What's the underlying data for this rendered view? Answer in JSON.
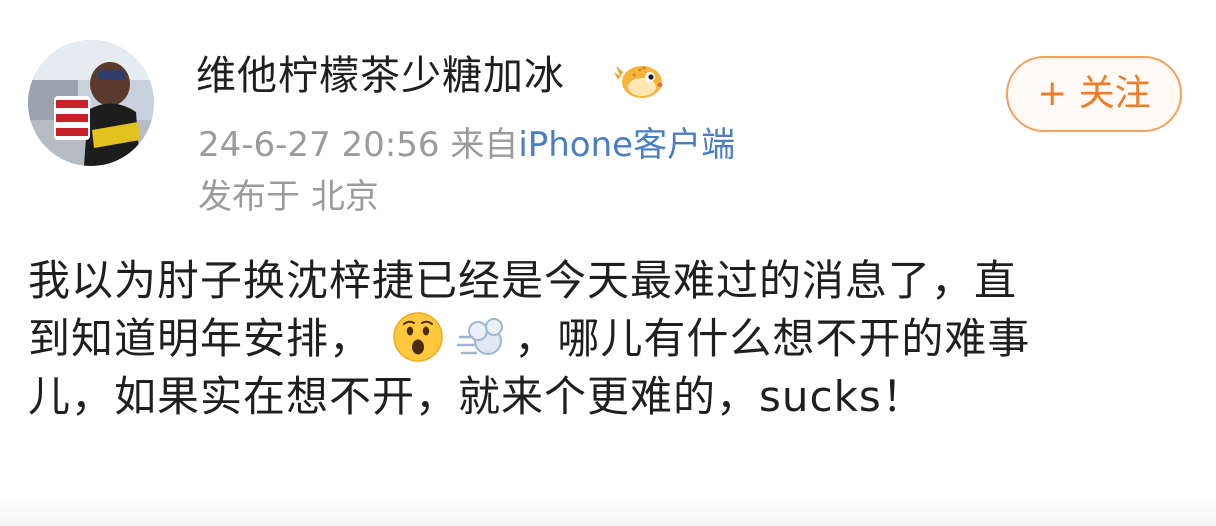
{
  "post": {
    "author": {
      "name": "维他柠檬茶少糖加冰",
      "avatar": "avatar-photo",
      "badge_icon": "pufferfish-badge-icon"
    },
    "follow_button": {
      "plus": "+",
      "label": "关注",
      "color": "#f07c27"
    },
    "timestamp": "24-6-27 20:56",
    "source_prefix": "来自",
    "source_name": "iPhone客户端",
    "location_prefix": "发布于",
    "location": "北京",
    "body": {
      "line1": "我以为肘子换沈梓捷已经是今天最难过的消息了，直",
      "line2_part1": "到知道明年安排，",
      "emoji1": "surprised-face-emoji",
      "emoji2": "dashing-away-emoji",
      "line2_part2": "，哪儿有什么想不开的难事",
      "line3": "儿，如果实在想不开，就来个更难的，sucks！"
    }
  },
  "colors": {
    "text": "#1f1f1f",
    "meta": "#9b9b9b",
    "link": "#4a7ec3",
    "accent": "#f07c27"
  }
}
